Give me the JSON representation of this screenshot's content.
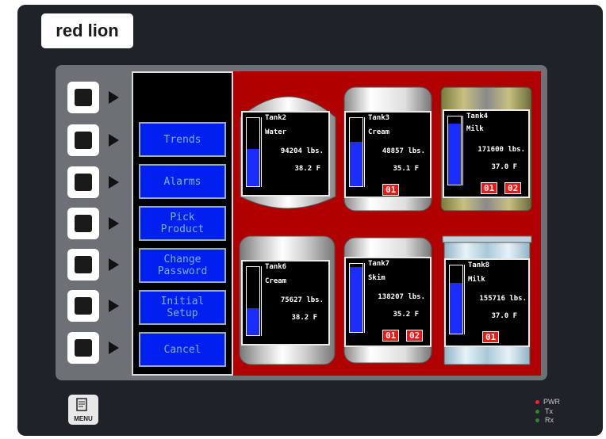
{
  "brand": {
    "logo_text": "red lion"
  },
  "side_menu": {
    "buttons": [
      "Trends",
      "Alarms",
      "Pick\nProduct",
      "Change\nPassword",
      "Initial\nSetup",
      "Cancel"
    ]
  },
  "tanks": [
    {
      "name": "Tank2",
      "product": "Water",
      "weight": "94204 lbs.",
      "temp": "38.2 F",
      "level": 0.55,
      "alarms": []
    },
    {
      "name": "Tank3",
      "product": "Cream",
      "weight": "48857 lbs.",
      "temp": "35.1 F",
      "level": 0.65,
      "alarms": [
        "01"
      ]
    },
    {
      "name": "Tank4",
      "product": "Milk",
      "weight": "171600 lbs.",
      "temp": "37.0 F",
      "level": 0.9,
      "alarms": [
        "01",
        "02"
      ]
    },
    {
      "name": "Tank6",
      "product": "Cream",
      "weight": "75627 lbs.",
      "temp": "38.2 F",
      "level": 0.4,
      "alarms": []
    },
    {
      "name": "Tank7",
      "product": "Skim",
      "weight": "138207 lbs.",
      "temp": "35.2 F",
      "level": 0.95,
      "alarms": [
        "01",
        "02"
      ]
    },
    {
      "name": "Tank8",
      "product": "Milk",
      "weight": "155716 lbs.",
      "temp": "37.0 F",
      "level": 0.75,
      "alarms": [
        "01"
      ]
    }
  ],
  "menu_key": {
    "label": "MENU"
  },
  "indicators": [
    {
      "label": "PWR",
      "color": "#ff2020"
    },
    {
      "label": "Tx",
      "color": "#2a8a2a"
    },
    {
      "label": "Rx",
      "color": "#2a8a2a"
    }
  ]
}
